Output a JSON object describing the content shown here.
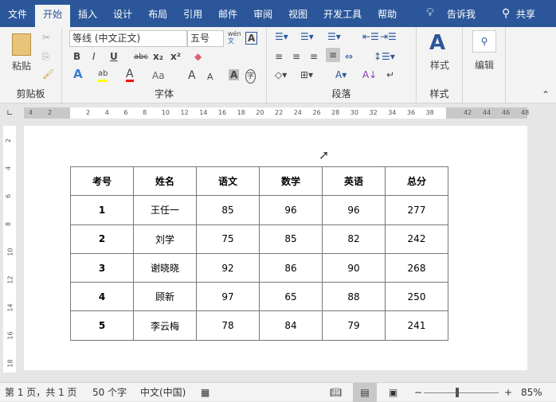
{
  "tabs": [
    "文件",
    "开始",
    "插入",
    "设计",
    "布局",
    "引用",
    "邮件",
    "审阅",
    "视图",
    "开发工具",
    "帮助"
  ],
  "tell_me": "告诉我",
  "share": "共享",
  "ribbon": {
    "paste": "粘贴",
    "clipboard": "剪贴板",
    "font_name": "等线 (中文正文)",
    "font_size": "五号",
    "font_group": "字体",
    "paragraph_group": "段落",
    "styles": "样式",
    "styles_group": "样式",
    "edit": "编辑",
    "wen": "wén",
    "wen_char": "文",
    "char_border": "A",
    "bold": "B",
    "italic": "I",
    "underline": "U",
    "strike": "abc",
    "sub": "x₂",
    "sup": "x²",
    "grow": "A",
    "shrink": "A",
    "case": "Aa",
    "zi": "字"
  },
  "ruler": {
    "left": [
      "4",
      "2"
    ],
    "main": [
      "2",
      "4",
      "6",
      "8",
      "10",
      "12",
      "14",
      "16",
      "18",
      "20",
      "22",
      "24",
      "26",
      "28",
      "30",
      "32",
      "34",
      "36",
      "38"
    ],
    "right": [
      "42",
      "44",
      "46",
      "48"
    ]
  },
  "vruler": [
    "2",
    "4",
    "6",
    "8",
    "10",
    "12",
    "14",
    "16",
    "18"
  ],
  "table": [
    [
      "考号",
      "姓名",
      "语文",
      "数学",
      "英语",
      "总分"
    ],
    [
      "1",
      "王任一",
      "85",
      "96",
      "96",
      "277"
    ],
    [
      "2",
      "刘学",
      "75",
      "85",
      "82",
      "242"
    ],
    [
      "3",
      "谢晓晓",
      "92",
      "86",
      "90",
      "268"
    ],
    [
      "4",
      "顾新",
      "97",
      "65",
      "88",
      "250"
    ],
    [
      "5",
      "李云梅",
      "78",
      "84",
      "79",
      "241"
    ]
  ],
  "status": {
    "page": "第 1 页，共 1 页",
    "words": "50 个字",
    "lang": "中文(中国)",
    "zoom": "85%"
  },
  "colors": {
    "brand": "#2b579a",
    "highlight": "#ffff00",
    "font_color": "#ff0000"
  }
}
